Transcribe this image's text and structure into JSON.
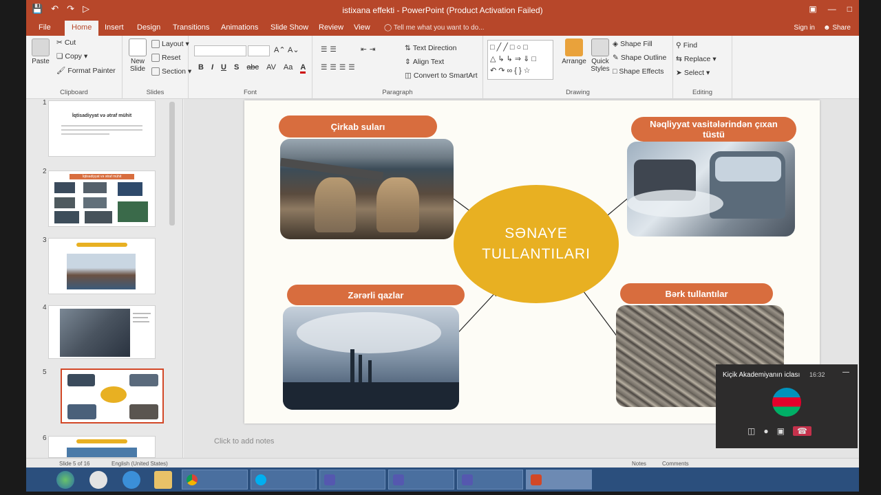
{
  "window": {
    "title": "istixana effekti - PowerPoint (Product Activation Failed)",
    "signin": "Sign in",
    "share": "Share"
  },
  "tabs": [
    "File",
    "Home",
    "Insert",
    "Design",
    "Transitions",
    "Animations",
    "Slide Show",
    "Review",
    "View"
  ],
  "tell_me": "Tell me what you want to do...",
  "ribbon": {
    "clipboard": {
      "paste": "Paste",
      "cut": "Cut",
      "copy": "Copy",
      "format_painter": "Format Painter",
      "label": "Clipboard"
    },
    "slides": {
      "new_slide": "New Slide",
      "layout": "Layout",
      "reset": "Reset",
      "section": "Section",
      "label": "Slides"
    },
    "font": {
      "label": "Font",
      "bold": "B",
      "italic": "I",
      "underline": "U",
      "shadow": "S",
      "strike": "abc",
      "spacing": "AV",
      "case": "Aa",
      "color": "A"
    },
    "paragraph": {
      "text_direction": "Text Direction",
      "align_text": "Align Text",
      "smartart": "Convert to SmartArt",
      "label": "Paragraph"
    },
    "drawing": {
      "arrange": "Arrange",
      "quick_styles": "Quick Styles",
      "shape_fill": "Shape Fill",
      "shape_outline": "Shape Outline",
      "shape_effects": "Shape Effects",
      "label": "Drawing"
    },
    "editing": {
      "find": "Find",
      "replace": "Replace",
      "select": "Select",
      "label": "Editing"
    }
  },
  "thumbnails": [
    {
      "num": "1",
      "title": "İqtisadiyyat və ətraf mühit"
    },
    {
      "num": "2",
      "title": "İqtisadiyyat və ətraf mühit"
    },
    {
      "num": "3",
      "title": ""
    },
    {
      "num": "4",
      "title": ""
    },
    {
      "num": "5",
      "title": ""
    },
    {
      "num": "6",
      "title": ""
    }
  ],
  "slide": {
    "center_line1": "SƏNAYE",
    "center_line2": "TULLANTILARI",
    "label_top_left": "Çirkab suları",
    "label_top_right": "Nəqliyyat vasitələrindən çıxan tüstü",
    "label_bottom_left": "Zərərli qazlar",
    "label_bottom_right": "Bərk tullantılar"
  },
  "notes_placeholder": "Click to add notes",
  "status": {
    "slide_info": "Slide 5 of 16",
    "language": "English (United States)",
    "notes": "Notes",
    "comments": "Comments"
  },
  "taskbar": [
    {
      "label": "",
      "app": "start"
    },
    {
      "label": "",
      "app": "media"
    },
    {
      "label": "",
      "app": "ie"
    },
    {
      "label": "",
      "app": "explorer"
    },
    {
      "label": "",
      "app": "chrome"
    },
    {
      "label": "",
      "app": "skype"
    },
    {
      "label": "",
      "app": "teams"
    },
    {
      "label": "",
      "app": "teams2"
    },
    {
      "label": "",
      "app": "teams3"
    },
    {
      "label": "",
      "app": "powerpoint"
    }
  ],
  "popup": {
    "title": "Kiçik Akademiyanın iclası",
    "time": "16:32"
  },
  "colors": {
    "accent": "#b7472a",
    "pill": "#d86d3e",
    "ellipse": "#e8b022"
  }
}
